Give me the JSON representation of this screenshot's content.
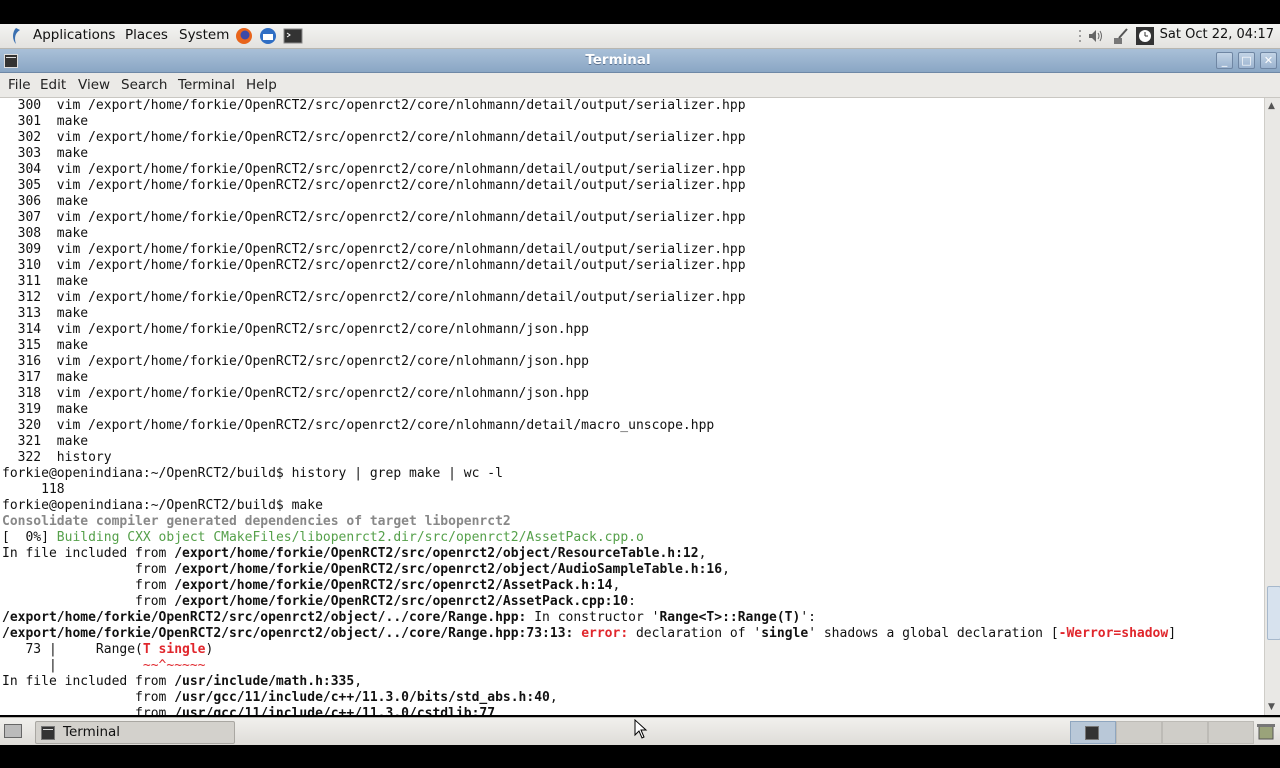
{
  "panel": {
    "menus": [
      "Applications",
      "Places",
      "System"
    ],
    "clock": "Sat Oct 22, 04:17"
  },
  "window": {
    "title": "Terminal",
    "buttons": [
      "_",
      "□",
      "✕"
    ]
  },
  "menubar": [
    "File",
    "Edit",
    "View",
    "Search",
    "Terminal",
    "Help"
  ],
  "terminal_lines": [
    [
      {
        "t": "  300  vim /export/home/forkie/OpenRCT2/src/openrct2/core/nlohmann/detail/output/serializer.hpp"
      }
    ],
    [
      {
        "t": "  301  make"
      }
    ],
    [
      {
        "t": "  302  vim /export/home/forkie/OpenRCT2/src/openrct2/core/nlohmann/detail/output/serializer.hpp"
      }
    ],
    [
      {
        "t": "  303  make"
      }
    ],
    [
      {
        "t": "  304  vim /export/home/forkie/OpenRCT2/src/openrct2/core/nlohmann/detail/output/serializer.hpp"
      }
    ],
    [
      {
        "t": "  305  vim /export/home/forkie/OpenRCT2/src/openrct2/core/nlohmann/detail/output/serializer.hpp"
      }
    ],
    [
      {
        "t": "  306  make"
      }
    ],
    [
      {
        "t": "  307  vim /export/home/forkie/OpenRCT2/src/openrct2/core/nlohmann/detail/output/serializer.hpp"
      }
    ],
    [
      {
        "t": "  308  make"
      }
    ],
    [
      {
        "t": "  309  vim /export/home/forkie/OpenRCT2/src/openrct2/core/nlohmann/detail/output/serializer.hpp"
      }
    ],
    [
      {
        "t": "  310  vim /export/home/forkie/OpenRCT2/src/openrct2/core/nlohmann/detail/output/serializer.hpp"
      }
    ],
    [
      {
        "t": "  311  make"
      }
    ],
    [
      {
        "t": "  312  vim /export/home/forkie/OpenRCT2/src/openrct2/core/nlohmann/detail/output/serializer.hpp"
      }
    ],
    [
      {
        "t": "  313  make"
      }
    ],
    [
      {
        "t": "  314  vim /export/home/forkie/OpenRCT2/src/openrct2/core/nlohmann/json.hpp"
      }
    ],
    [
      {
        "t": "  315  make"
      }
    ],
    [
      {
        "t": "  316  vim /export/home/forkie/OpenRCT2/src/openrct2/core/nlohmann/json.hpp"
      }
    ],
    [
      {
        "t": "  317  make"
      }
    ],
    [
      {
        "t": "  318  vim /export/home/forkie/OpenRCT2/src/openrct2/core/nlohmann/json.hpp"
      }
    ],
    [
      {
        "t": "  319  make"
      }
    ],
    [
      {
        "t": "  320  vim /export/home/forkie/OpenRCT2/src/openrct2/core/nlohmann/detail/macro_unscope.hpp"
      }
    ],
    [
      {
        "t": "  321  make"
      }
    ],
    [
      {
        "t": "  322  history"
      }
    ],
    [
      {
        "t": "forkie@openindiana:~/OpenRCT2/build$ history | grep make | wc -l"
      }
    ],
    [
      {
        "t": "     118"
      }
    ],
    [
      {
        "t": "forkie@openindiana:~/OpenRCT2/build$ make"
      }
    ],
    [
      {
        "t": "Consolidate compiler generated dependencies of target libopenrct2",
        "c": "grey"
      }
    ],
    [
      {
        "t": "[  0%] "
      },
      {
        "t": "Building CXX object CMakeFiles/libopenrct2.dir/src/openrct2/AssetPack.cpp.o",
        "c": "green"
      }
    ],
    [
      {
        "t": "In file included from "
      },
      {
        "t": "/export/home/forkie/OpenRCT2/src/openrct2/object/ResourceTable.h:12",
        "c": "b"
      },
      {
        "t": ","
      }
    ],
    [
      {
        "t": "                 from "
      },
      {
        "t": "/export/home/forkie/OpenRCT2/src/openrct2/object/AudioSampleTable.h:16",
        "c": "b"
      },
      {
        "t": ","
      }
    ],
    [
      {
        "t": "                 from "
      },
      {
        "t": "/export/home/forkie/OpenRCT2/src/openrct2/AssetPack.h:14",
        "c": "b"
      },
      {
        "t": ","
      }
    ],
    [
      {
        "t": "                 from "
      },
      {
        "t": "/export/home/forkie/OpenRCT2/src/openrct2/AssetPack.cpp:10",
        "c": "b"
      },
      {
        "t": ":"
      }
    ],
    [
      {
        "t": "/export/home/forkie/OpenRCT2/src/openrct2/object/../core/Range.hpp:",
        "c": "b"
      },
      {
        "t": " In constructor '"
      },
      {
        "t": "Range<T>::Range(T)",
        "c": "b"
      },
      {
        "t": "':"
      }
    ],
    [
      {
        "t": "/export/home/forkie/OpenRCT2/src/openrct2/object/../core/Range.hpp:73:13:",
        "c": "b"
      },
      {
        "t": " "
      },
      {
        "t": "error:",
        "c": "red"
      },
      {
        "t": " declaration of '"
      },
      {
        "t": "single",
        "c": "b"
      },
      {
        "t": "' shadows a global declaration ["
      },
      {
        "t": "-Werror=shadow",
        "c": "red"
      },
      {
        "t": "]"
      }
    ],
    [
      {
        "t": "   73 |     Range("
      },
      {
        "t": "T single",
        "c": "red"
      },
      {
        "t": ")"
      }
    ],
    [
      {
        "t": "      |           "
      },
      {
        "t": "~~^~~~~~",
        "c": "redn"
      }
    ],
    [
      {
        "t": "In file included from "
      },
      {
        "t": "/usr/include/math.h:335",
        "c": "b"
      },
      {
        "t": ","
      }
    ],
    [
      {
        "t": "                 from "
      },
      {
        "t": "/usr/gcc/11/include/c++/11.3.0/bits/std_abs.h:40",
        "c": "b"
      },
      {
        "t": ","
      }
    ],
    [
      {
        "t": "                 from "
      },
      {
        "t": "/usr/gcc/11/include/c++/11.3.0/cstdlib:77",
        "c": "b"
      }
    ]
  ],
  "taskbar": {
    "task_label": "Terminal"
  }
}
